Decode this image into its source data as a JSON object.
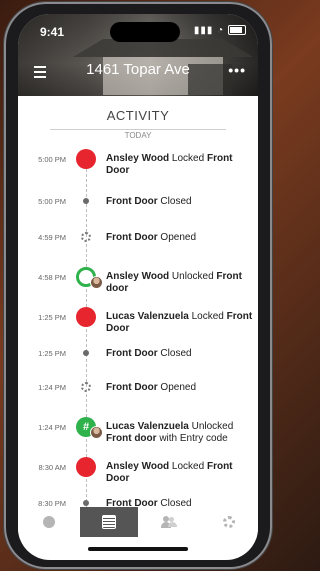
{
  "status_bar": {
    "time": "9:41"
  },
  "header": {
    "address": "1461 Topar Ave"
  },
  "activity": {
    "title": "ACTIVITY",
    "section": "TODAY"
  },
  "events": [
    {
      "time": "5:00 PM",
      "type": "locked",
      "segments": [
        {
          "b": true,
          "t": "Ansley Wood"
        },
        {
          "b": false,
          "t": " Locked "
        },
        {
          "b": true,
          "t": "Front Door"
        }
      ]
    },
    {
      "time": "5:00 PM",
      "type": "closed",
      "segments": [
        {
          "b": true,
          "t": "Front Door"
        },
        {
          "b": false,
          "t": " Closed"
        }
      ]
    },
    {
      "time": "4:59 PM",
      "type": "opened",
      "segments": [
        {
          "b": true,
          "t": "Front Door"
        },
        {
          "b": false,
          "t": " Opened"
        }
      ]
    },
    {
      "time": "4:58 PM",
      "type": "unlocked",
      "segments": [
        {
          "b": true,
          "t": "Ansley Wood"
        },
        {
          "b": false,
          "t": " Unlocked "
        },
        {
          "b": true,
          "t": "Front door"
        }
      ]
    },
    {
      "time": "1:25 PM",
      "type": "locked",
      "segments": [
        {
          "b": true,
          "t": "Lucas Valenzuela"
        },
        {
          "b": false,
          "t": " Locked "
        },
        {
          "b": true,
          "t": "Front Door"
        }
      ]
    },
    {
      "time": "1:25 PM",
      "type": "closed",
      "segments": [
        {
          "b": true,
          "t": "Front Door"
        },
        {
          "b": false,
          "t": " Closed"
        }
      ]
    },
    {
      "time": "1:24 PM",
      "type": "opened",
      "segments": [
        {
          "b": true,
          "t": "Front Door"
        },
        {
          "b": false,
          "t": " Opened"
        }
      ]
    },
    {
      "time": "1:24 PM",
      "type": "code",
      "segments": [
        {
          "b": true,
          "t": "Lucas Valenzuela"
        },
        {
          "b": false,
          "t": " Unlocked "
        },
        {
          "b": true,
          "t": "Front door"
        },
        {
          "b": false,
          "t": " with Entry code"
        }
      ]
    },
    {
      "time": "8:30 AM",
      "type": "locked",
      "segments": [
        {
          "b": true,
          "t": "Ansley Wood"
        },
        {
          "b": false,
          "t": " Locked "
        },
        {
          "b": true,
          "t": "Front Door"
        }
      ]
    },
    {
      "time": "8:30 PM",
      "type": "closed",
      "segments": [
        {
          "b": true,
          "t": "Front Door"
        },
        {
          "b": false,
          "t": " Closed"
        }
      ]
    }
  ],
  "nav": [
    {
      "name": "status-icon",
      "active": false
    },
    {
      "name": "activity-list-icon",
      "active": true
    },
    {
      "name": "users-icon",
      "active": false
    },
    {
      "name": "settings-icon",
      "active": false
    }
  ],
  "colors": {
    "locked": "#e6252e",
    "unlocked": "#2fb14b",
    "nav_active": "#555555"
  }
}
